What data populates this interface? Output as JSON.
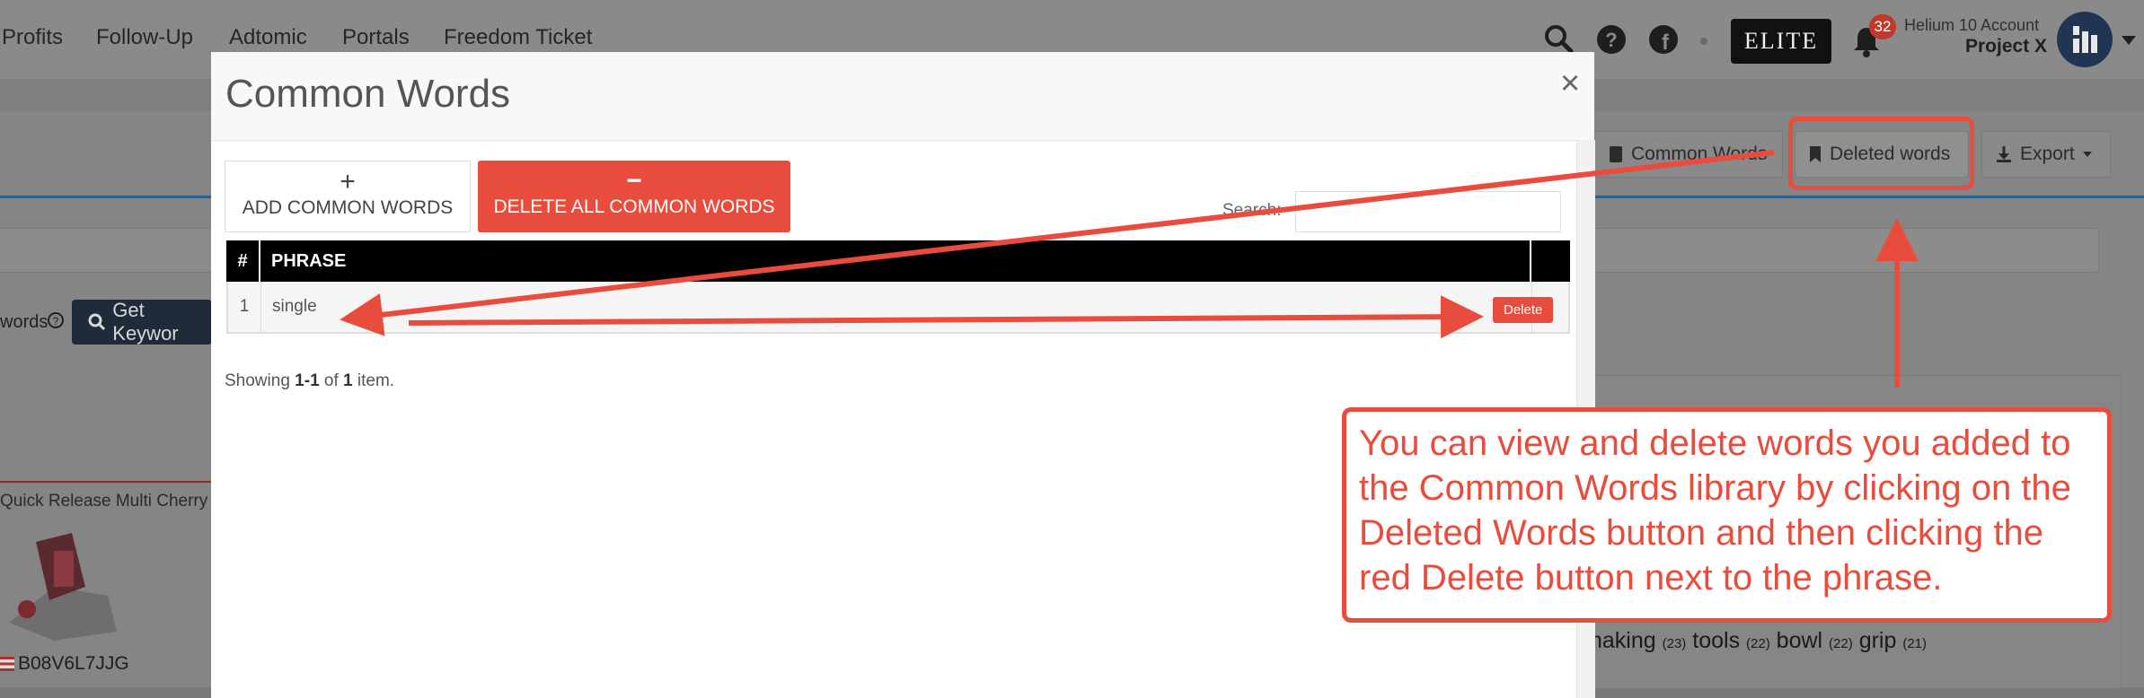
{
  "topnav": {
    "items": [
      "Profits",
      "Follow-Up",
      "Adtomic",
      "Portals",
      "Freedom Ticket"
    ],
    "elite_label": "ELITE",
    "notification_count": "32",
    "account_label": "Helium 10 Account",
    "account_name": "Project X"
  },
  "toolbar": {
    "common_words_label": "Common Words",
    "deleted_words_label": "Deleted words",
    "export_label": "Export"
  },
  "background": {
    "words_label": "words",
    "get_keywords_label": "Get Keywor",
    "product_title": "Quick Release Multi Cherry",
    "asin": "B08V6L7JJG",
    "word_cloud": [
      {
        "word": "naking",
        "count": "(23)"
      },
      {
        "word": "tools",
        "count": "(22)"
      },
      {
        "word": "bowl",
        "count": "(22)"
      },
      {
        "word": "grip",
        "count": "(21)"
      }
    ]
  },
  "modal": {
    "title": "Common Words",
    "close_symbol": "×",
    "add_button": {
      "icon": "+",
      "label": "ADD COMMON WORDS"
    },
    "delete_all_button": {
      "icon": "−",
      "label": "DELETE ALL COMMON WORDS"
    },
    "search_label": "Search:",
    "search_value": "",
    "table": {
      "headers": [
        "#",
        "PHRASE",
        ""
      ],
      "rows": [
        {
          "index": "1",
          "phrase": "single",
          "action": "Delete"
        }
      ]
    },
    "summary": {
      "prefix": "Showing ",
      "range": "1-1",
      "middle": " of ",
      "total": "1",
      "suffix": " item."
    }
  },
  "annotation": {
    "text": "You can view and delete words you added to the Common Words library by clicking on the Deleted Words button and then clicking the red Delete button next to the phrase.",
    "color": "#e74c3c"
  }
}
